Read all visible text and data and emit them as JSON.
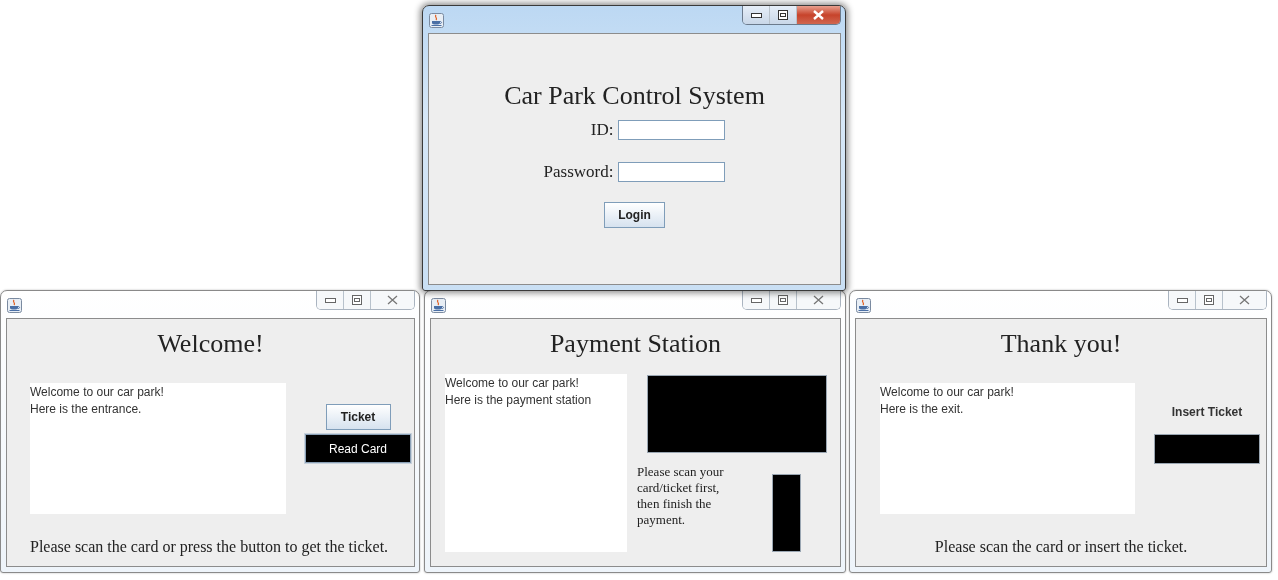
{
  "windows": [
    {
      "kind": "login",
      "active": true,
      "heading": "Car Park Control System",
      "fields": [
        {
          "label": "ID:"
        },
        {
          "label": "Password:"
        }
      ],
      "button": "Login"
    },
    {
      "kind": "entrance",
      "active": false,
      "heading": "Welcome!",
      "message_lines": [
        "Welcome to our car park!",
        "Here is the entrance."
      ],
      "buttons": [
        "Ticket",
        "Read Card"
      ],
      "footer": "Please scan the card or press the button to get the ticket."
    },
    {
      "kind": "payment",
      "active": false,
      "heading": "Payment Station",
      "message_lines": [
        "Welcome to our car park!",
        "Here is the payment station"
      ],
      "instructions": "Please scan your card/ticket first, then finish the payment."
    },
    {
      "kind": "exit",
      "active": false,
      "heading": "Thank you!",
      "message_lines": [
        "Welcome to our car park!",
        "Here is the exit."
      ],
      "label": "Insert Ticket",
      "footer": "Please scan the card or insert the ticket."
    }
  ]
}
